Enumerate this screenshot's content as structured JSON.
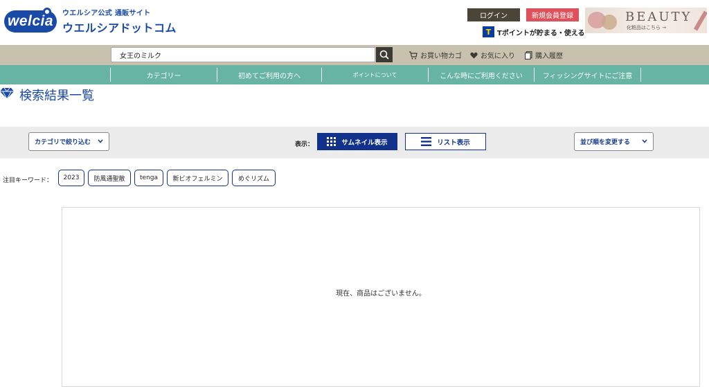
{
  "header": {
    "logo_sub": "ウエルシア公式 通販サイト",
    "logo_main": "ウエルシアドットコム",
    "logo_badge": "welcia",
    "login_label": "ログイン",
    "register_label": "新規会員登録",
    "tpoint_icon": "T",
    "tpoint_text": "Tポイントが貯まる・使える",
    "beauty_title": "BEAUTY",
    "beauty_sub": "化粧品はこちら →"
  },
  "search": {
    "value": "女王のミルク",
    "icon": "search-icon"
  },
  "utility": {
    "cart_label": "お買い物カゴ",
    "favorites_label": "お気に入り",
    "history_label": "購入履歴"
  },
  "nav": {
    "items": [
      "カテゴリー",
      "初めてご利用の方へ",
      "ポイントについて",
      "こんな時にご利用ください",
      "フィッシングサイトにご注意"
    ]
  },
  "page": {
    "title": "検索結果一覧"
  },
  "toolbar": {
    "category_select": "カテゴリで絞り込む",
    "view_label": "表示：",
    "thumbnail_label": "サムネイル表示",
    "list_label": "リスト表示",
    "sort_select": "並び順を変更する"
  },
  "keywords": {
    "label": "注目キーワード：",
    "items": [
      "2023",
      "防風通聖散",
      "tenga",
      "新ビオフェルミン",
      "めぐリズム"
    ]
  },
  "results": {
    "empty_message": "現在、商品はございません。"
  },
  "colors": {
    "brand_blue": "#1a4aa8",
    "nav_green": "#67b4a3",
    "search_bar": "#c7c1ad",
    "login_bg": "#4b4537",
    "register_bg": "#e0505a",
    "active_view": "#11318a"
  }
}
